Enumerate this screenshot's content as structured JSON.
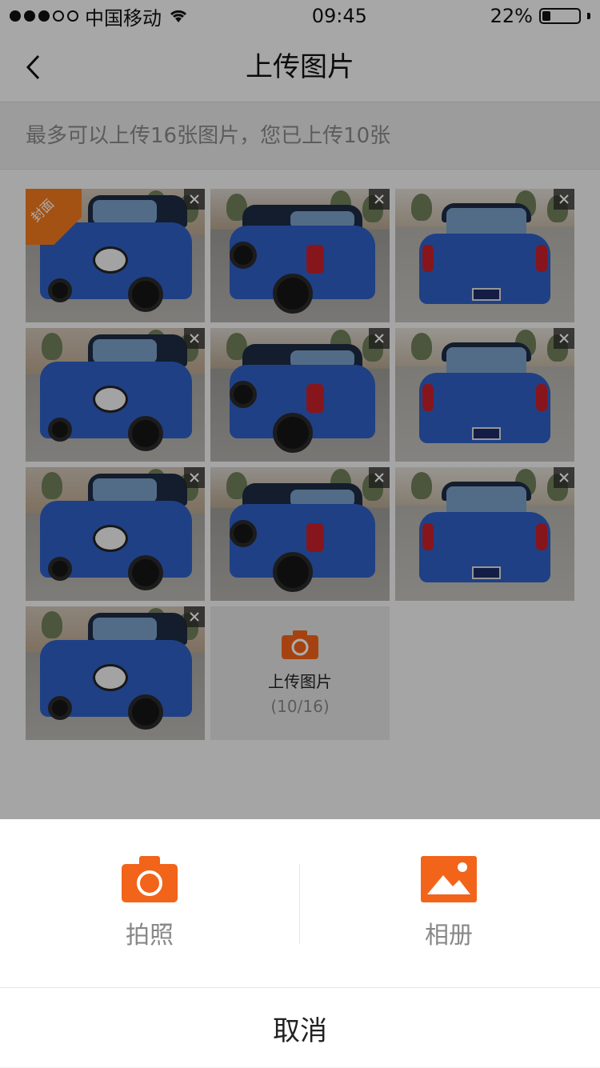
{
  "status_bar": {
    "carrier": "中国移动",
    "time": "09:45",
    "battery_percent": "22%",
    "signal_dots_filled": 3,
    "signal_dots_total": 5,
    "battery_level": 0.22
  },
  "nav": {
    "title": "上传图片",
    "back_icon": "chevron-left-icon"
  },
  "info": {
    "message": "最多可以上传16张图片，您已上传10张"
  },
  "grid": {
    "photos": [
      {
        "type": "front",
        "cover": true
      },
      {
        "type": "side"
      },
      {
        "type": "rear"
      },
      {
        "type": "front"
      },
      {
        "type": "side"
      },
      {
        "type": "rear"
      },
      {
        "type": "front"
      },
      {
        "type": "side"
      },
      {
        "type": "rear"
      },
      {
        "type": "front"
      }
    ],
    "cover_badge": "封面",
    "upload_tile": {
      "label": "上传图片",
      "count": "(10/16)",
      "icon": "camera-icon"
    }
  },
  "action_sheet": {
    "camera_label": "拍照",
    "album_label": "相册",
    "cancel_label": "取消",
    "accent_color": "#f2641a"
  },
  "colors": {
    "accent": "#f2641a",
    "cover_badge": "#f07a1e",
    "car_blue": "#2e5fc4"
  }
}
